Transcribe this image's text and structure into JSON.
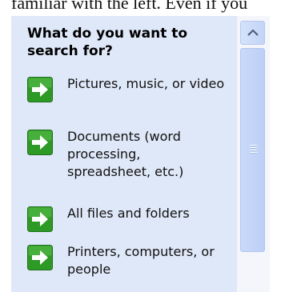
{
  "cutoff_text": "familiar with the left. Even if you",
  "pane": {
    "title": "What do you want to search for?",
    "options": [
      {
        "label": "Pictures, music, or video",
        "icon": "green-arrow-icon"
      },
      {
        "label": "Documents (word processing, spreadsheet, etc.)",
        "icon": "green-arrow-icon"
      },
      {
        "label": "All files and folders",
        "icon": "green-arrow-icon"
      },
      {
        "label": "Printers, computers, or people",
        "icon": "green-arrow-icon"
      }
    ]
  },
  "colors": {
    "pane_background": "#dfe8f8",
    "arrow_green": "#2e9a26",
    "scrollbar_thumb": "#c3d4f6"
  }
}
